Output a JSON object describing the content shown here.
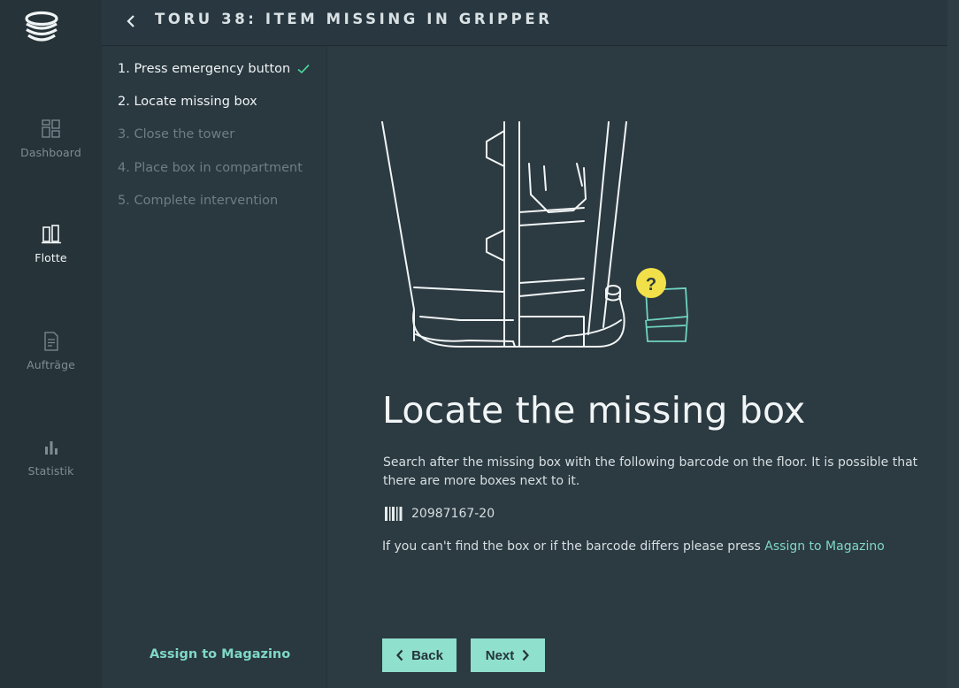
{
  "nav": {
    "items": [
      {
        "label": "Dashboard",
        "icon": "dashboard-icon",
        "active": false
      },
      {
        "label": "Flotte",
        "icon": "fleet-icon",
        "active": true
      },
      {
        "label": "Aufträge",
        "icon": "document-icon",
        "active": false
      },
      {
        "label": "Statistik",
        "icon": "bar-chart-icon",
        "active": false
      }
    ]
  },
  "header": {
    "title": "TORU 38: ITEM MISSING IN GRIPPER"
  },
  "steps": [
    {
      "label": "1. Press emergency button",
      "state": "done"
    },
    {
      "label": "2. Locate missing box",
      "state": "current"
    },
    {
      "label": "3. Close the tower",
      "state": "todo"
    },
    {
      "label": "4. Place box in compartment",
      "state": "todo"
    },
    {
      "label": "5. Complete intervention",
      "state": "todo"
    }
  ],
  "sidebar_footer": {
    "assign_label": "Assign to Magazino"
  },
  "main": {
    "question_mark": "?",
    "heading": "Locate the missing box",
    "description": "Search after the missing box with the following barcode on the floor. It is possible that there are more boxes next to it.",
    "barcode": "20987167-20",
    "help_prefix": "If you can't find the box or if the barcode differs please press ",
    "help_link": "Assign to Magazino"
  },
  "buttons": {
    "back": "Back",
    "next": "Next"
  },
  "colors": {
    "accent": "#7fd8c6",
    "button": "#8fe0cc",
    "check": "#4cd39a",
    "question_badge": "#f2e04a",
    "box_outline": "#6fd4c2"
  }
}
